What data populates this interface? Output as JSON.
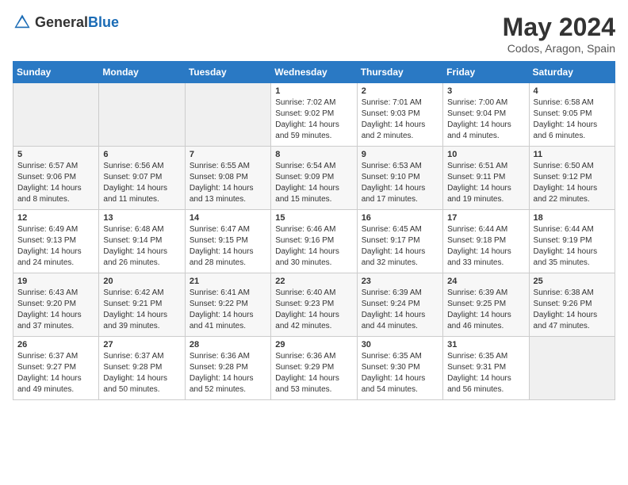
{
  "header": {
    "logo_general": "General",
    "logo_blue": "Blue",
    "month": "May 2024",
    "location": "Codos, Aragon, Spain"
  },
  "days_of_week": [
    "Sunday",
    "Monday",
    "Tuesday",
    "Wednesday",
    "Thursday",
    "Friday",
    "Saturday"
  ],
  "weeks": [
    [
      {
        "num": "",
        "info": ""
      },
      {
        "num": "",
        "info": ""
      },
      {
        "num": "",
        "info": ""
      },
      {
        "num": "1",
        "info": "Sunrise: 7:02 AM\nSunset: 9:02 PM\nDaylight: 14 hours\nand 59 minutes."
      },
      {
        "num": "2",
        "info": "Sunrise: 7:01 AM\nSunset: 9:03 PM\nDaylight: 14 hours\nand 2 minutes."
      },
      {
        "num": "3",
        "info": "Sunrise: 7:00 AM\nSunset: 9:04 PM\nDaylight: 14 hours\nand 4 minutes."
      },
      {
        "num": "4",
        "info": "Sunrise: 6:58 AM\nSunset: 9:05 PM\nDaylight: 14 hours\nand 6 minutes."
      }
    ],
    [
      {
        "num": "5",
        "info": "Sunrise: 6:57 AM\nSunset: 9:06 PM\nDaylight: 14 hours\nand 8 minutes."
      },
      {
        "num": "6",
        "info": "Sunrise: 6:56 AM\nSunset: 9:07 PM\nDaylight: 14 hours\nand 11 minutes."
      },
      {
        "num": "7",
        "info": "Sunrise: 6:55 AM\nSunset: 9:08 PM\nDaylight: 14 hours\nand 13 minutes."
      },
      {
        "num": "8",
        "info": "Sunrise: 6:54 AM\nSunset: 9:09 PM\nDaylight: 14 hours\nand 15 minutes."
      },
      {
        "num": "9",
        "info": "Sunrise: 6:53 AM\nSunset: 9:10 PM\nDaylight: 14 hours\nand 17 minutes."
      },
      {
        "num": "10",
        "info": "Sunrise: 6:51 AM\nSunset: 9:11 PM\nDaylight: 14 hours\nand 19 minutes."
      },
      {
        "num": "11",
        "info": "Sunrise: 6:50 AM\nSunset: 9:12 PM\nDaylight: 14 hours\nand 22 minutes."
      }
    ],
    [
      {
        "num": "12",
        "info": "Sunrise: 6:49 AM\nSunset: 9:13 PM\nDaylight: 14 hours\nand 24 minutes."
      },
      {
        "num": "13",
        "info": "Sunrise: 6:48 AM\nSunset: 9:14 PM\nDaylight: 14 hours\nand 26 minutes."
      },
      {
        "num": "14",
        "info": "Sunrise: 6:47 AM\nSunset: 9:15 PM\nDaylight: 14 hours\nand 28 minutes."
      },
      {
        "num": "15",
        "info": "Sunrise: 6:46 AM\nSunset: 9:16 PM\nDaylight: 14 hours\nand 30 minutes."
      },
      {
        "num": "16",
        "info": "Sunrise: 6:45 AM\nSunset: 9:17 PM\nDaylight: 14 hours\nand 32 minutes."
      },
      {
        "num": "17",
        "info": "Sunrise: 6:44 AM\nSunset: 9:18 PM\nDaylight: 14 hours\nand 33 minutes."
      },
      {
        "num": "18",
        "info": "Sunrise: 6:44 AM\nSunset: 9:19 PM\nDaylight: 14 hours\nand 35 minutes."
      }
    ],
    [
      {
        "num": "19",
        "info": "Sunrise: 6:43 AM\nSunset: 9:20 PM\nDaylight: 14 hours\nand 37 minutes."
      },
      {
        "num": "20",
        "info": "Sunrise: 6:42 AM\nSunset: 9:21 PM\nDaylight: 14 hours\nand 39 minutes."
      },
      {
        "num": "21",
        "info": "Sunrise: 6:41 AM\nSunset: 9:22 PM\nDaylight: 14 hours\nand 41 minutes."
      },
      {
        "num": "22",
        "info": "Sunrise: 6:40 AM\nSunset: 9:23 PM\nDaylight: 14 hours\nand 42 minutes."
      },
      {
        "num": "23",
        "info": "Sunrise: 6:39 AM\nSunset: 9:24 PM\nDaylight: 14 hours\nand 44 minutes."
      },
      {
        "num": "24",
        "info": "Sunrise: 6:39 AM\nSunset: 9:25 PM\nDaylight: 14 hours\nand 46 minutes."
      },
      {
        "num": "25",
        "info": "Sunrise: 6:38 AM\nSunset: 9:26 PM\nDaylight: 14 hours\nand 47 minutes."
      }
    ],
    [
      {
        "num": "26",
        "info": "Sunrise: 6:37 AM\nSunset: 9:27 PM\nDaylight: 14 hours\nand 49 minutes."
      },
      {
        "num": "27",
        "info": "Sunrise: 6:37 AM\nSunset: 9:28 PM\nDaylight: 14 hours\nand 50 minutes."
      },
      {
        "num": "28",
        "info": "Sunrise: 6:36 AM\nSunset: 9:28 PM\nDaylight: 14 hours\nand 52 minutes."
      },
      {
        "num": "29",
        "info": "Sunrise: 6:36 AM\nSunset: 9:29 PM\nDaylight: 14 hours\nand 53 minutes."
      },
      {
        "num": "30",
        "info": "Sunrise: 6:35 AM\nSunset: 9:30 PM\nDaylight: 14 hours\nand 54 minutes."
      },
      {
        "num": "31",
        "info": "Sunrise: 6:35 AM\nSunset: 9:31 PM\nDaylight: 14 hours\nand 56 minutes."
      },
      {
        "num": "",
        "info": ""
      }
    ]
  ]
}
